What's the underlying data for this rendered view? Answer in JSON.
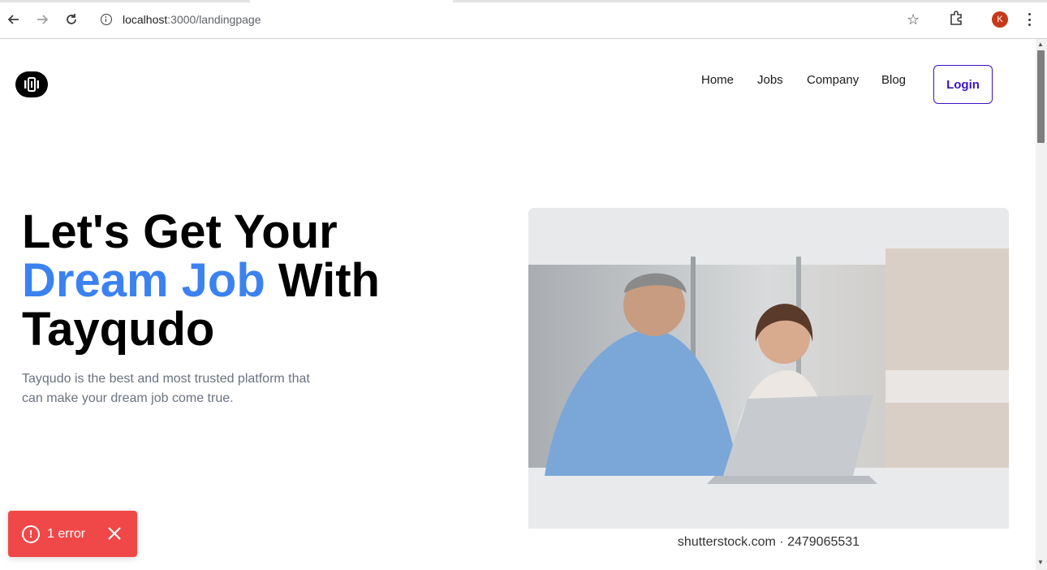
{
  "browser": {
    "url_host": "localhost",
    "url_path": ":3000/landingpage",
    "profile_initial": "K"
  },
  "nav": {
    "items": [
      "Home",
      "Jobs",
      "Company",
      "Blog"
    ],
    "login_label": "Login"
  },
  "hero": {
    "title_line1": "Let's Get Your",
    "title_accent": "Dream Job",
    "title_line2_rest": " With",
    "title_line3": "Tayqudo",
    "subtitle": "Tayqudo is the best and most trusted platform that can make your dream job come true.",
    "image_caption": "shutterstock.com · 2479065531"
  },
  "toast": {
    "text": "1 error",
    "icon_glyph": "!"
  },
  "colors": {
    "accent": "#3b82f0",
    "login_border": "#3d14c8",
    "toast_bg": "#f04848"
  },
  "icons": [
    "back-arrow-icon",
    "forward-arrow-icon",
    "reload-icon",
    "info-icon",
    "star-icon",
    "extensions-icon",
    "kebab-menu-icon",
    "alert-circle-icon",
    "close-icon"
  ]
}
